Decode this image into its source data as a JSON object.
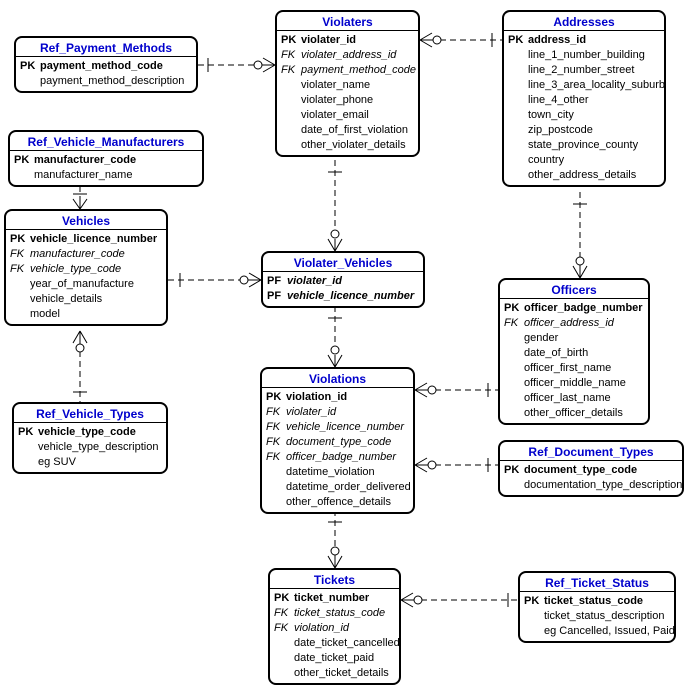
{
  "entities": {
    "ref_payment_methods": {
      "title": "Ref_Payment_Methods",
      "attrs": [
        {
          "key": "PK",
          "name": "payment_method_code",
          "cls": "pk"
        },
        {
          "key": "",
          "name": "payment_method_description",
          "cls": ""
        }
      ]
    },
    "ref_vehicle_manufacturers": {
      "title": "Ref_Vehicle_Manufacturers",
      "attrs": [
        {
          "key": "PK",
          "name": "manufacturer_code",
          "cls": "pk"
        },
        {
          "key": "",
          "name": "manufacturer_name",
          "cls": ""
        }
      ]
    },
    "vehicles": {
      "title": "Vehicles",
      "attrs": [
        {
          "key": "PK",
          "name": "vehicle_licence_number",
          "cls": "pk"
        },
        {
          "key": "FK",
          "name": "manufacturer_code",
          "cls": "fk"
        },
        {
          "key": "FK",
          "name": "vehicle_type_code",
          "cls": "fk"
        },
        {
          "key": "",
          "name": "year_of_manufacture",
          "cls": ""
        },
        {
          "key": "",
          "name": "vehicle_details",
          "cls": ""
        },
        {
          "key": "",
          "name": "model",
          "cls": ""
        }
      ]
    },
    "ref_vehicle_types": {
      "title": "Ref_Vehicle_Types",
      "attrs": [
        {
          "key": "PK",
          "name": "vehicle_type_code",
          "cls": "pk"
        },
        {
          "key": "",
          "name": "vehicle_type_description",
          "cls": ""
        },
        {
          "key": "",
          "name": "eg SUV",
          "cls": "note"
        }
      ]
    },
    "violaters": {
      "title": "Violaters",
      "attrs": [
        {
          "key": "PK",
          "name": "violater_id",
          "cls": "pk"
        },
        {
          "key": "FK",
          "name": "violater_address_id",
          "cls": "fk"
        },
        {
          "key": "FK",
          "name": "payment_method_code",
          "cls": "fk"
        },
        {
          "key": "",
          "name": "violater_name",
          "cls": ""
        },
        {
          "key": "",
          "name": "violater_phone",
          "cls": ""
        },
        {
          "key": "",
          "name": "violater_email",
          "cls": ""
        },
        {
          "key": "",
          "name": "date_of_first_violation",
          "cls": ""
        },
        {
          "key": "",
          "name": "other_violater_details",
          "cls": ""
        }
      ]
    },
    "violater_vehicles": {
      "title": "Violater_Vehicles",
      "attrs": [
        {
          "key": "PF",
          "name": "violater_id",
          "cls": "pf"
        },
        {
          "key": "PF",
          "name": "vehicle_licence_number",
          "cls": "pf"
        }
      ]
    },
    "violations": {
      "title": "Violations",
      "attrs": [
        {
          "key": "PK",
          "name": "violation_id",
          "cls": "pk"
        },
        {
          "key": "FK",
          "name": "violater_id",
          "cls": "fk"
        },
        {
          "key": "FK",
          "name": "vehicle_licence_number",
          "cls": "fk"
        },
        {
          "key": "FK",
          "name": "document_type_code",
          "cls": "fk"
        },
        {
          "key": "FK",
          "name": "officer_badge_number",
          "cls": "fk"
        },
        {
          "key": "",
          "name": "datetime_violation",
          "cls": ""
        },
        {
          "key": "",
          "name": "datetime_order_delivered",
          "cls": ""
        },
        {
          "key": "",
          "name": "other_offence_details",
          "cls": ""
        }
      ]
    },
    "tickets": {
      "title": "Tickets",
      "attrs": [
        {
          "key": "PK",
          "name": "ticket_number",
          "cls": "pk"
        },
        {
          "key": "FK",
          "name": "ticket_status_code",
          "cls": "fk"
        },
        {
          "key": "FK",
          "name": "violation_id",
          "cls": "fk"
        },
        {
          "key": "",
          "name": "date_ticket_cancelled",
          "cls": ""
        },
        {
          "key": "",
          "name": "date_ticket_paid",
          "cls": ""
        },
        {
          "key": "",
          "name": "other_ticket_details",
          "cls": ""
        }
      ]
    },
    "addresses": {
      "title": "Addresses",
      "attrs": [
        {
          "key": "PK",
          "name": "address_id",
          "cls": "pk"
        },
        {
          "key": "",
          "name": "line_1_number_building",
          "cls": ""
        },
        {
          "key": "",
          "name": "line_2_number_street",
          "cls": ""
        },
        {
          "key": "",
          "name": "line_3_area_locality_suburb",
          "cls": ""
        },
        {
          "key": "",
          "name": "line_4_other",
          "cls": ""
        },
        {
          "key": "",
          "name": "town_city",
          "cls": ""
        },
        {
          "key": "",
          "name": "zip_postcode",
          "cls": ""
        },
        {
          "key": "",
          "name": "state_province_county",
          "cls": ""
        },
        {
          "key": "",
          "name": "country",
          "cls": ""
        },
        {
          "key": "",
          "name": "other_address_details",
          "cls": ""
        }
      ]
    },
    "officers": {
      "title": "Officers",
      "attrs": [
        {
          "key": "PK",
          "name": "officer_badge_number",
          "cls": "pk"
        },
        {
          "key": "FK",
          "name": "officer_address_id",
          "cls": "fk"
        },
        {
          "key": "",
          "name": "gender",
          "cls": ""
        },
        {
          "key": "",
          "name": "date_of_birth",
          "cls": ""
        },
        {
          "key": "",
          "name": "officer_first_name",
          "cls": ""
        },
        {
          "key": "",
          "name": "officer_middle_name",
          "cls": ""
        },
        {
          "key": "",
          "name": "officer_last_name",
          "cls": ""
        },
        {
          "key": "",
          "name": "other_officer_details",
          "cls": ""
        }
      ]
    },
    "ref_document_types": {
      "title": "Ref_Document_Types",
      "attrs": [
        {
          "key": "PK",
          "name": "document_type_code",
          "cls": "pk"
        },
        {
          "key": "",
          "name": "documentation_type_description",
          "cls": ""
        }
      ]
    },
    "ref_ticket_status": {
      "title": "Ref_Ticket_Status",
      "attrs": [
        {
          "key": "PK",
          "name": "ticket_status_code",
          "cls": "pk"
        },
        {
          "key": "",
          "name": "ticket_status_description",
          "cls": ""
        },
        {
          "key": "",
          "name": "eg Cancelled, Issued, Paid",
          "cls": "note"
        }
      ]
    }
  },
  "relationships": [
    {
      "from": "Violaters",
      "to": "Ref_Payment_Methods",
      "via": "payment_method_code"
    },
    {
      "from": "Violaters",
      "to": "Addresses",
      "via": "violater_address_id"
    },
    {
      "from": "Vehicles",
      "to": "Ref_Vehicle_Manufacturers",
      "via": "manufacturer_code"
    },
    {
      "from": "Vehicles",
      "to": "Ref_Vehicle_Types",
      "via": "vehicle_type_code"
    },
    {
      "from": "Violater_Vehicles",
      "to": "Violaters",
      "via": "violater_id"
    },
    {
      "from": "Violater_Vehicles",
      "to": "Vehicles",
      "via": "vehicle_licence_number"
    },
    {
      "from": "Violations",
      "to": "Violater_Vehicles",
      "via": "violater_id,vehicle_licence_number"
    },
    {
      "from": "Violations",
      "to": "Officers",
      "via": "officer_badge_number"
    },
    {
      "from": "Violations",
      "to": "Ref_Document_Types",
      "via": "document_type_code"
    },
    {
      "from": "Tickets",
      "to": "Violations",
      "via": "violation_id"
    },
    {
      "from": "Tickets",
      "to": "Ref_Ticket_Status",
      "via": "ticket_status_code"
    },
    {
      "from": "Officers",
      "to": "Addresses",
      "via": "officer_address_id"
    }
  ]
}
